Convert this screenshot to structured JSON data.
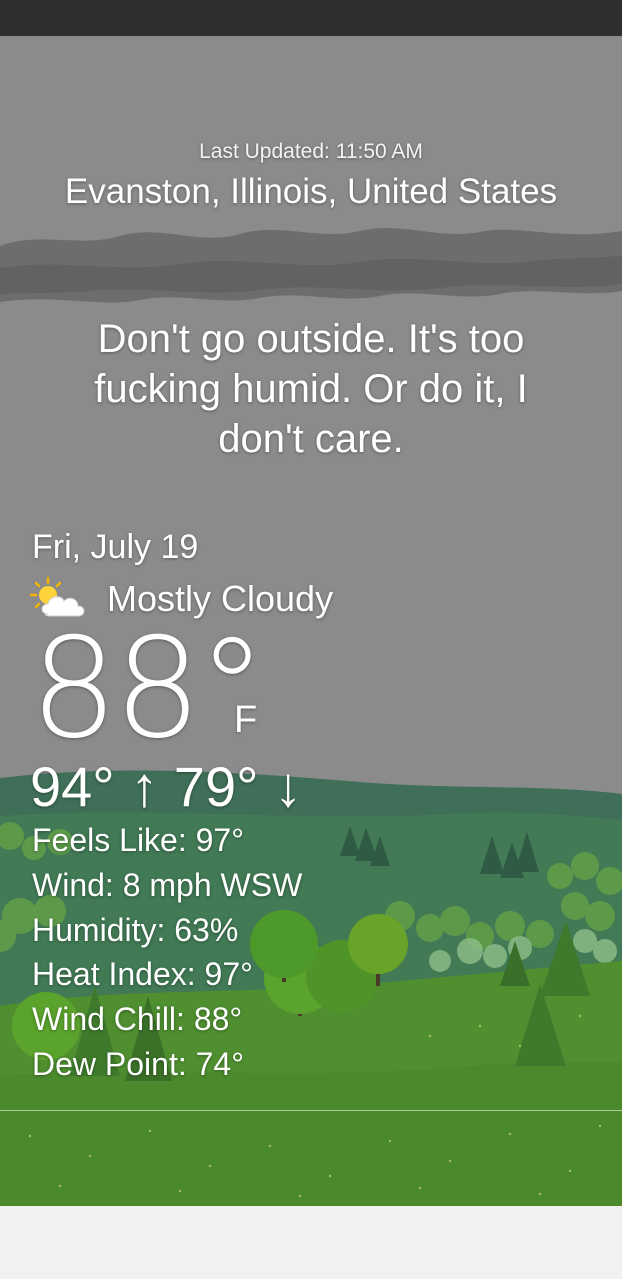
{
  "header": {
    "last_updated": "Last Updated: 11:50 AM",
    "location": "Evanston, Illinois, United States"
  },
  "message": "Don't go outside. It's too fucking humid. Or do it, I don't care.",
  "forecast": {
    "date": "Fri, July 19",
    "condition": "Mostly Cloudy",
    "condition_icon": "partly-cloudy-icon",
    "temperature": "88°",
    "unit": "F",
    "hi_lo": "94° ↑ 79° ↓"
  },
  "details": {
    "feels_like": "Feels Like: 97°",
    "wind": "Wind: 8 mph WSW",
    "humidity": "Humidity: 63%",
    "heat_index": "Heat Index: 97°",
    "wind_chill": "Wind Chill: 88°",
    "dew_point": "Dew Point: 74°"
  },
  "colors": {
    "sky": "#8a8a8a",
    "cloud_band": "#6f6f6f",
    "hills": "#3f7a5a",
    "grass": "#4a8c2e",
    "status_bar": "#2f2f2f"
  }
}
